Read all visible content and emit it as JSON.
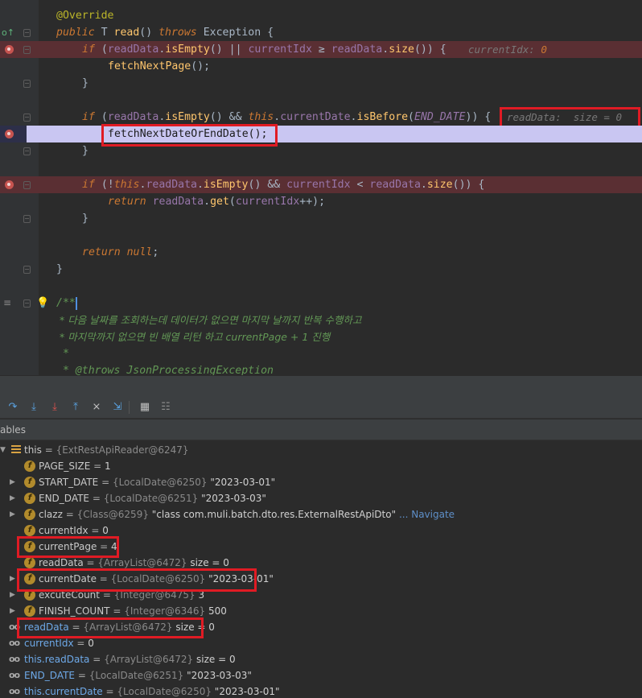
{
  "editor": {
    "annotation": "@Override",
    "sig_public": "public",
    "sig_type": "T",
    "sig_method": "read",
    "sig_parens": "()",
    "sig_throws": "throws",
    "sig_exception": "Exception {",
    "l3_if": "if",
    "l3_readData": "readData",
    "l3_isEmpty": "isEmpty",
    "l3_currentIdx": "currentIdx",
    "l3_readData2": "readData",
    "l3_size": "size",
    "l3_hint_label": "currentIdx:",
    "l3_hint_value": "0",
    "l4_method": "fetchNextPage",
    "l6_if": "if",
    "l6_readData": "readData",
    "l6_isEmpty": "isEmpty",
    "l6_this": "this",
    "l6_currentDate": "currentDate",
    "l6_isBefore": "isBefore",
    "l6_const": "END_DATE",
    "l6_hint": "readData:  size = 0",
    "l7_call": "fetchNextDateOrEndDate();",
    "l9_if": "if",
    "l9_this": "this",
    "l9_readData": "readData",
    "l9_isEmpty": "isEmpty",
    "l9_currentIdx": "currentIdx",
    "l9_readData2": "readData",
    "l9_size": "size",
    "l10_return": "return",
    "l10_readData": "readData",
    "l10_get": "get",
    "l10_currentIdx": "currentIdx",
    "l13_return": "return",
    "l13_null": "null",
    "c_open": "/**",
    "c1": " * 다음 날짜를 조회하는데 데이터가 없으면 마지막 날까지 반복 수행하고",
    "c2": " * 마지막까지 없으면 빈 배열 리턴 하고 currentPage + 1 진행",
    "c3": " *",
    "c4": " * @throws JsonProcessingException"
  },
  "panel": {
    "variables_label": "ables"
  },
  "variables": [
    {
      "name": "this",
      "ref": "{ExtRestApiReader@6247}",
      "value": "",
      "icon": "list-icon",
      "indent": 0,
      "expand": "open"
    },
    {
      "name": "PAGE_SIZE",
      "ref": "",
      "value": "1",
      "icon": "field-icon",
      "indent": 1,
      "expand": "none"
    },
    {
      "name": "START_DATE",
      "ref": "{LocalDate@6250}",
      "value": "\"2023-03-01\"",
      "icon": "field-icon",
      "indent": 1,
      "expand": "closed"
    },
    {
      "name": "END_DATE",
      "ref": "{LocalDate@6251}",
      "value": "\"2023-03-03\"",
      "icon": "field-icon",
      "indent": 1,
      "expand": "closed"
    },
    {
      "name": "clazz",
      "ref": "{Class@6259}",
      "value": "\"class com.muli.batch.dto.res.ExternalRestApiDto\"",
      "nav": "... Navigate",
      "icon": "field-icon",
      "indent": 1,
      "expand": "closed"
    },
    {
      "name": "currentIdx",
      "ref": "",
      "value": "0",
      "icon": "field-icon",
      "indent": 1,
      "expand": "none"
    },
    {
      "name": "currentPage",
      "ref": "",
      "value": "4",
      "icon": "field-icon",
      "indent": 1,
      "expand": "none"
    },
    {
      "name": "readData",
      "ref": "{ArrayList@6472}",
      "value": " size = 0",
      "icon": "field-icon",
      "indent": 1,
      "expand": "none"
    },
    {
      "name": "currentDate",
      "ref": "{LocalDate@6250}",
      "value": "\"2023-03-01\"",
      "icon": "field-icon",
      "indent": 1,
      "expand": "closed"
    },
    {
      "name": "excuteCount",
      "ref": "{Integer@6475}",
      "value": "3",
      "icon": "field-icon",
      "indent": 1,
      "expand": "closed"
    },
    {
      "name": "FINISH_COUNT",
      "ref": "{Integer@6346}",
      "value": "500",
      "icon": "field-icon",
      "indent": 1,
      "expand": "closed"
    },
    {
      "name": "readData",
      "ref": "{ArrayList@6472}",
      "value": " size = 0",
      "icon": "watch-icon",
      "indent": 0,
      "expand": "none"
    },
    {
      "name": "currentIdx",
      "ref": "",
      "value": "0",
      "icon": "watch-icon",
      "indent": 0,
      "expand": "none"
    },
    {
      "name": "this.readData",
      "ref": "{ArrayList@6472}",
      "value": " size = 0",
      "icon": "watch-icon",
      "indent": 0,
      "expand": "none"
    },
    {
      "name": "END_DATE",
      "ref": "{LocalDate@6251}",
      "value": "\"2023-03-03\"",
      "icon": "watch-icon",
      "indent": 0,
      "expand": "none"
    },
    {
      "name": "this.currentDate",
      "ref": "{LocalDate@6250}",
      "value": "\"2023-03-01\"",
      "icon": "watch-icon",
      "indent": 0,
      "expand": "none"
    }
  ]
}
